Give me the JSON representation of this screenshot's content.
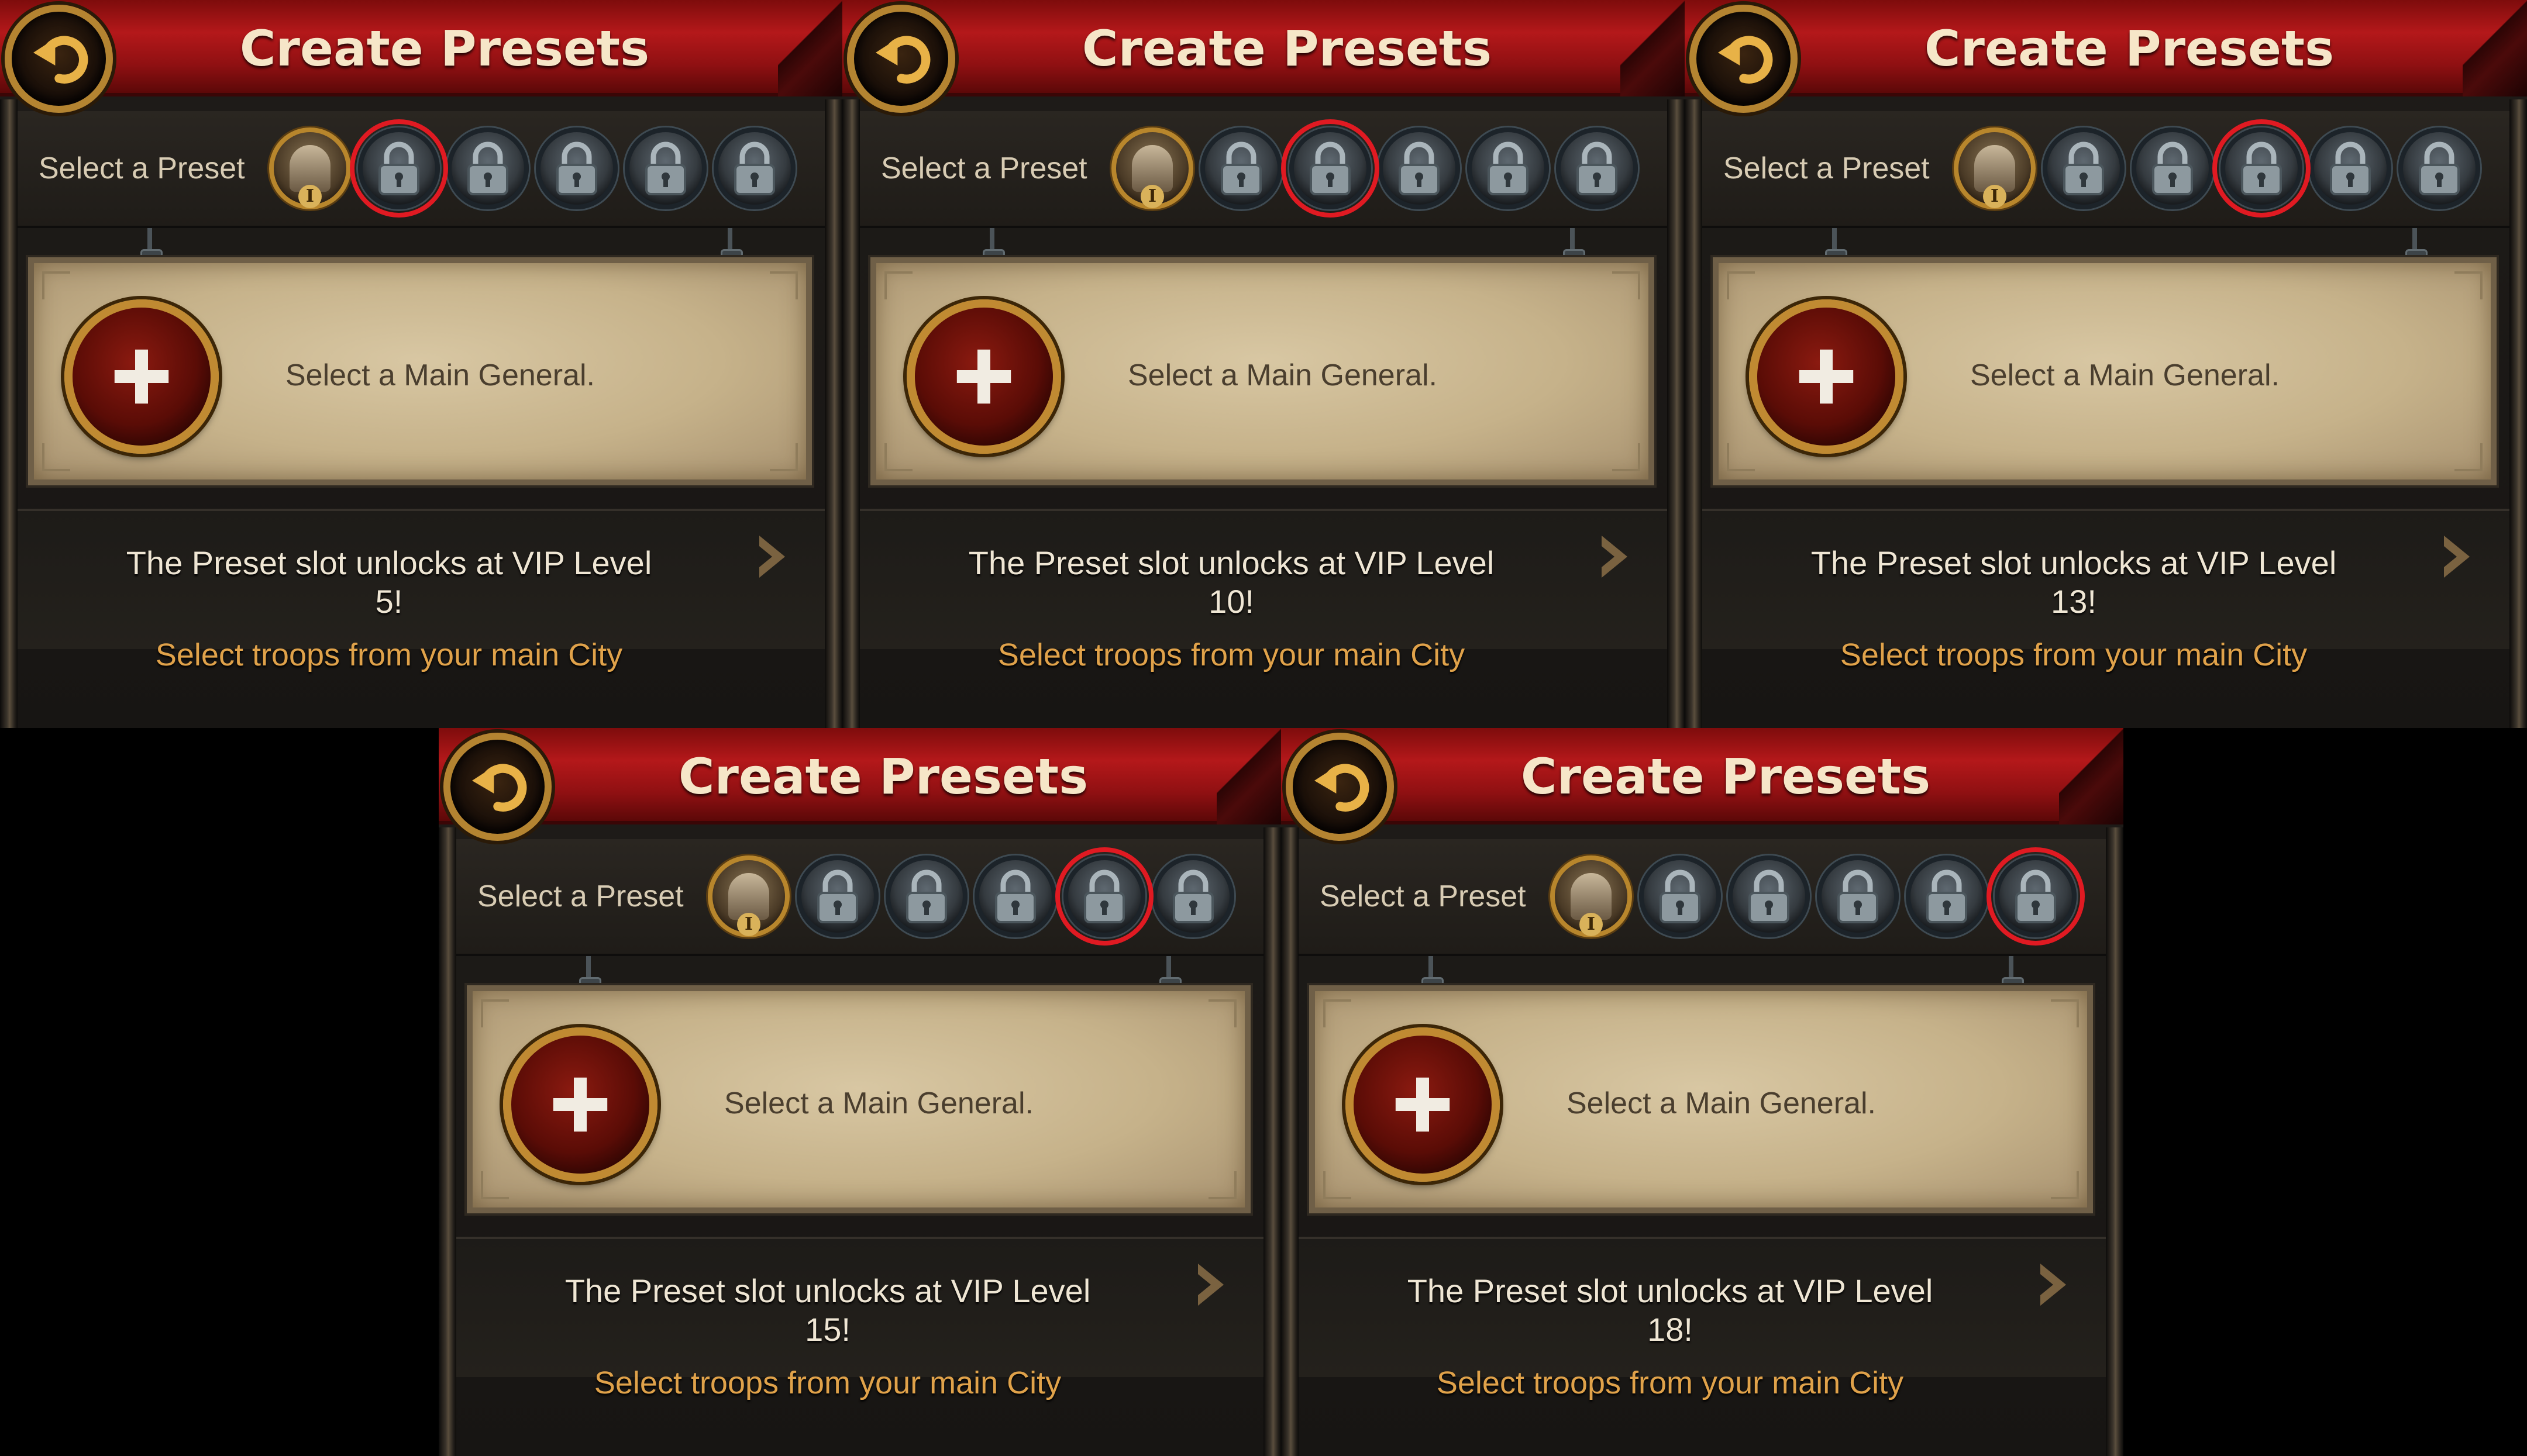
{
  "panels": [
    {
      "title": "Create Presets",
      "preset_label": "Select a Preset",
      "highlighted_slot": 2,
      "card_text": "Select a Main General.",
      "unlock_line1": "The Preset slot unlocks at VIP Level",
      "unlock_line2": "5!",
      "troops_text": "Select troops from your main City"
    },
    {
      "title": "Create Presets",
      "preset_label": "Select a Preset",
      "highlighted_slot": 3,
      "card_text": "Select a Main General.",
      "unlock_line1": "The Preset slot unlocks at VIP Level",
      "unlock_line2": "10!",
      "troops_text": "Select troops from your main City"
    },
    {
      "title": "Create Presets",
      "preset_label": "Select a Preset",
      "highlighted_slot": 4,
      "card_text": "Select a Main General.",
      "unlock_line1": "The Preset slot unlocks at VIP Level",
      "unlock_line2": "13!",
      "troops_text": "Select troops from your main City"
    },
    {
      "title": "Create Presets",
      "preset_label": "Select a Preset",
      "highlighted_slot": 5,
      "card_text": "Select a Main General.",
      "unlock_line1": "The Preset slot unlocks at VIP Level",
      "unlock_line2": "15!",
      "troops_text": "Select troops from your main City"
    },
    {
      "title": "Create Presets",
      "preset_label": "Select a Preset",
      "highlighted_slot": 6,
      "card_text": "Select a Main General.",
      "unlock_line1": "The Preset slot unlocks at VIP Level",
      "unlock_line2": "18!",
      "troops_text": "Select troops from your main City"
    }
  ],
  "first_slot_numeral": "I",
  "icons": {
    "back": "back-arrow-icon",
    "lock": "lock-icon",
    "add": "plus-icon",
    "next": "chevron-right-icon"
  },
  "colors": {
    "highlight": "#e01a22",
    "header": "#b4181a",
    "troops_text": "#e0a24a"
  }
}
